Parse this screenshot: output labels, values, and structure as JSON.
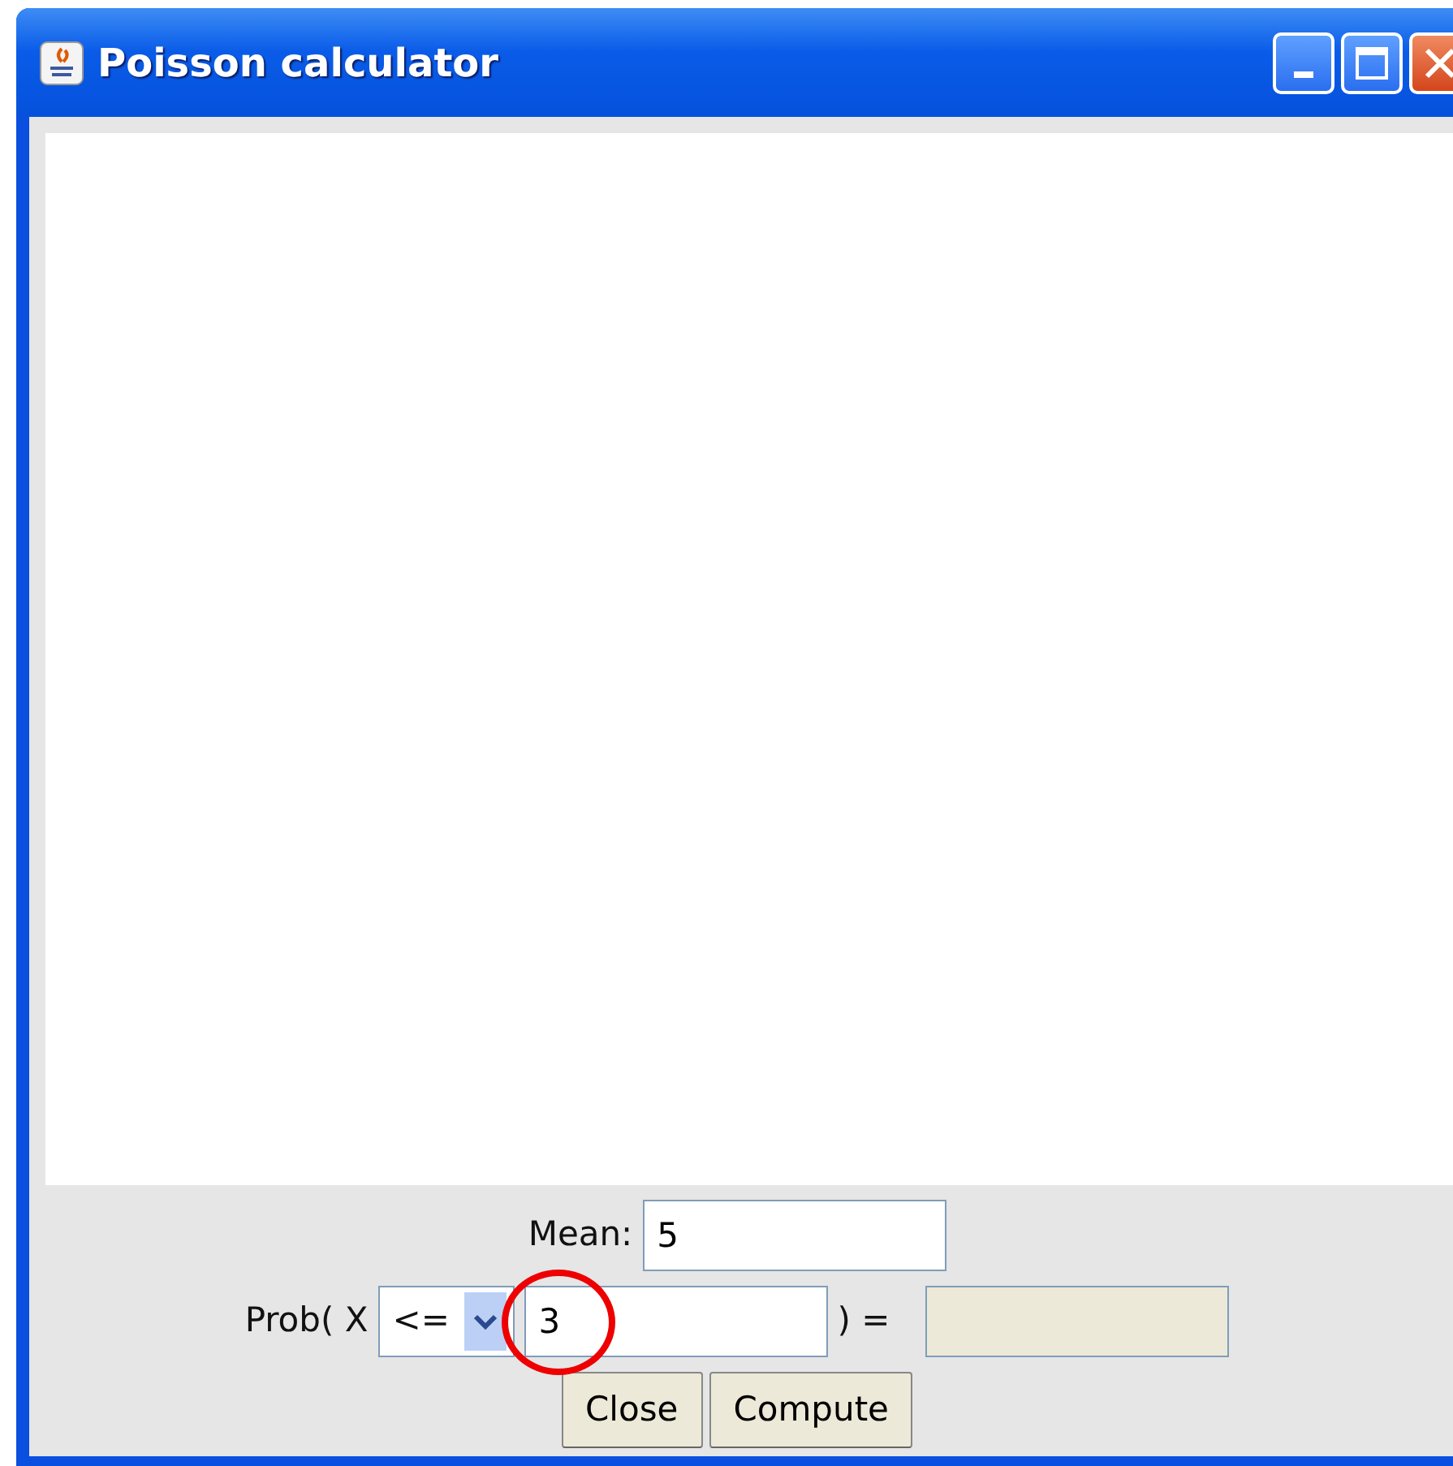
{
  "window": {
    "title": "Poisson calculator"
  },
  "mean": {
    "label": "Mean:",
    "value": "5"
  },
  "probability": {
    "label": "Prob( X",
    "operator": "<=",
    "value": "3",
    "highlighted": true,
    "equals": ") =",
    "result": {
      "disabled": true
    }
  },
  "buttons": [
    {
      "label": "Close"
    },
    {
      "label": "Compute"
    }
  ]
}
